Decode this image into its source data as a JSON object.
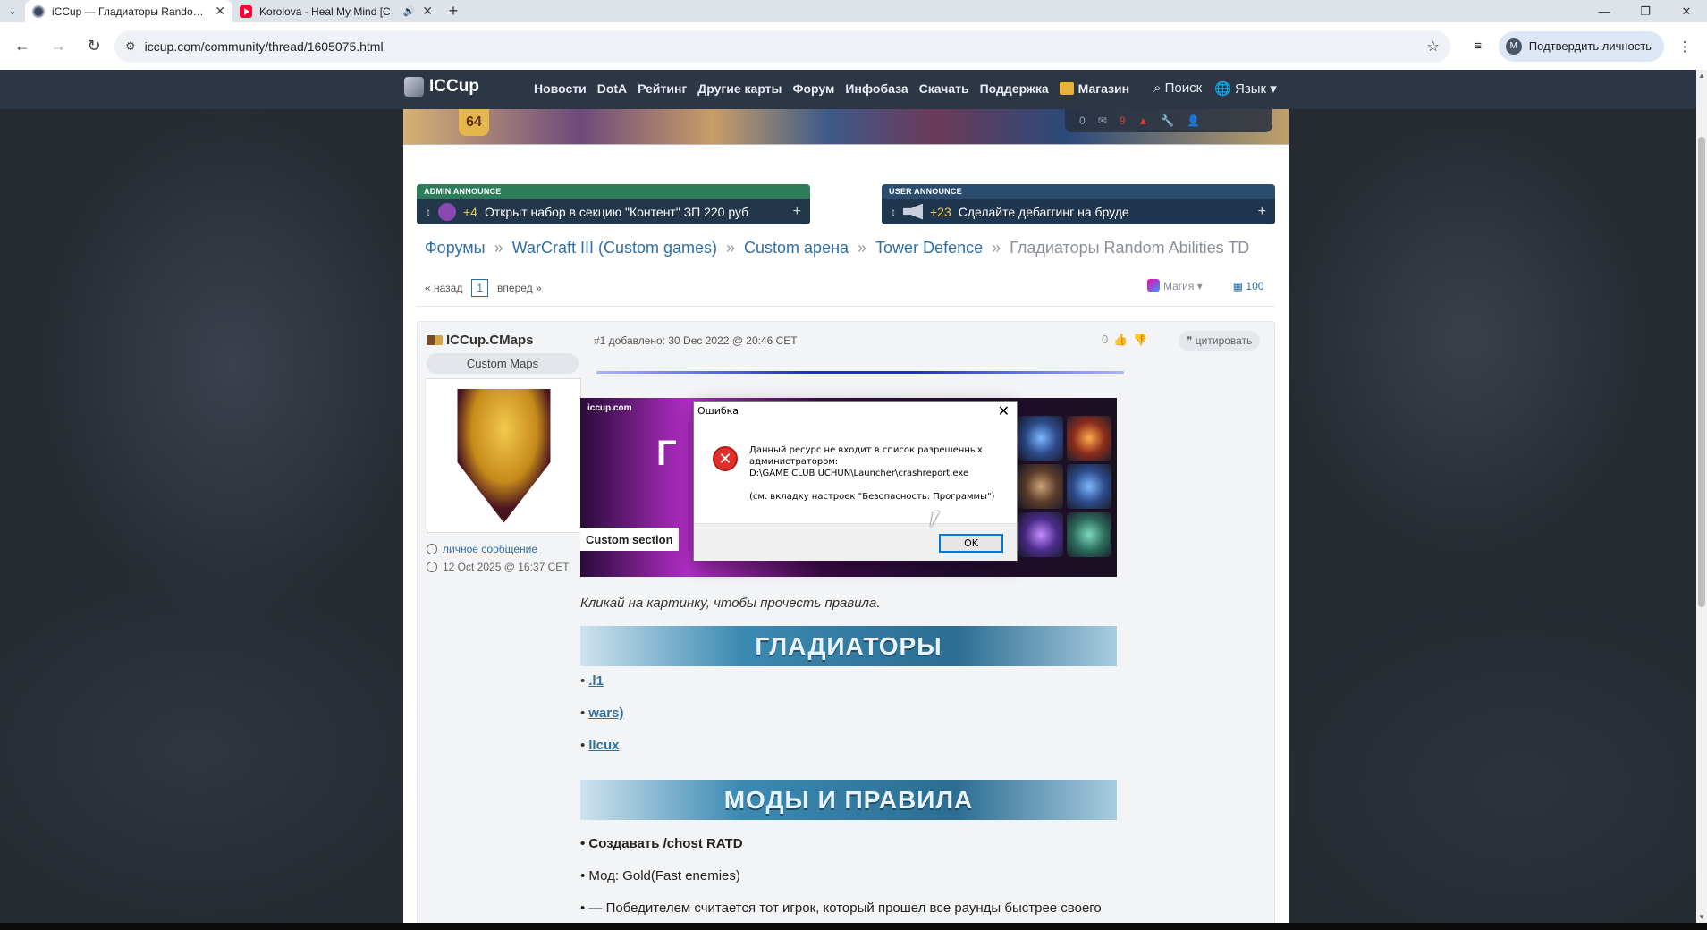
{
  "browser": {
    "tabs": [
      {
        "title": "iCCup — Гладиаторы Random Abilities TD",
        "active": true
      },
      {
        "title": "Korolova - Heal My Mind [C",
        "active": false
      }
    ],
    "url": "iccup.com/community/thread/1605075.html",
    "verify_label": "Подтвердить личность",
    "profile_initial": "M"
  },
  "site": {
    "logo": "ICCup",
    "menu": [
      "Новости",
      "DotA",
      "Рейтинг",
      "Другие карты",
      "Форум",
      "Инфобаза",
      "Скачать",
      "Поддержка",
      "Магазин"
    ],
    "search_label": "Поиск",
    "lang_label": "Язык ▾",
    "level": "64",
    "messages_count": "0",
    "alerts_count": "9"
  },
  "announces": {
    "admin": {
      "label": "ADMIN ANNOUNCE",
      "count": "+4",
      "text": "Открыт набор в секцию \"Контент\" ЗП 220 руб"
    },
    "user": {
      "label": "USER ANNOUNCE",
      "count": "+23",
      "text": "Сделайте дебаггинг на бруде"
    }
  },
  "breadcrumb": [
    "Форумы",
    "WarCraft III (Custom games)",
    "Custom арена",
    "Tower Defence",
    "Гладиаторы Random Abilities TD"
  ],
  "pager": {
    "prev": "« назад",
    "page": "1",
    "next": "вперед »"
  },
  "tools": {
    "magic": "Магия ▾",
    "count": "100"
  },
  "post": {
    "author": "ICCup.CMaps",
    "group": "Custom Maps",
    "pm_link": "личное сообщение",
    "side_date": "12 Oct 2025 @ 16:37 CET",
    "meta": "#1 добавлено: 30 Dec 2022 @ 20:46 CET",
    "votes": "0",
    "quote_label": "цитировать",
    "image_site": "iccup.com",
    "image_glyph": "Г",
    "image_caption": "Custom section",
    "hint": "Кликай на картинку, чтобы прочесть правила.",
    "banner_gladiators": "ГЛАДИАТОРЫ",
    "list": [
      ".l1",
      "wars)",
      "llcux"
    ],
    "banner_mods": "МОДЫ И ПРАВИЛА",
    "rules": [
      "• Создавать /chost RATD",
      "• Мод: Gold(Fast enemies)",
      "• — Победителем считается тот игрок, который прошел все раунды быстрее своего"
    ]
  },
  "dialog": {
    "title": "Ошибка",
    "message_line1": "Данный ресурс не входит в список разрешенных администратором:",
    "message_path": "D:\\GAME CLUB UCHUN\\Launcher\\crashreport.exe",
    "message_hint": "(см. вкладку настроек \"Безопасность: Программы\")",
    "ok_label": "OK"
  }
}
